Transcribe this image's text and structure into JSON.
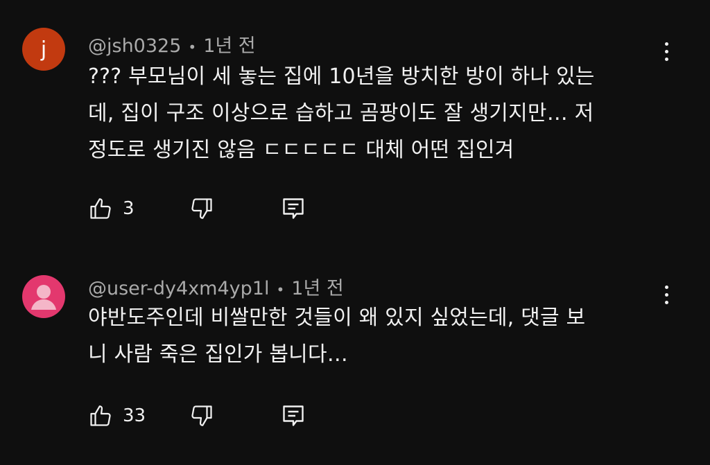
{
  "comments": [
    {
      "avatar_letter": "j",
      "avatar_color": "#c23a10",
      "author": "@jsh0325",
      "time": "1년 전",
      "text": "??? 부모님이 세 놓는 집에 10년을 방치한 방이 하나 있는\n데, 집이 구조 이상으로 습하고 곰팡이도 잘 생기지만… 저\n정도로 생기진 않음 ㄷㄷㄷㄷㄷ 대체 어떤 집인겨",
      "likes": "3"
    },
    {
      "avatar_color": "#e3386e",
      "author": "@user-dy4xm4yp1l",
      "time": "1년 전",
      "text": "야반도주인데 비쌀만한 것들이 왜 있지 싶었는데, 댓글 보\n니 사람 죽은 집인가 봅니다…",
      "likes": "33"
    }
  ],
  "separator": "•",
  "icons": {
    "like": "thumbs-up-icon",
    "dislike": "thumbs-down-icon",
    "reply": "comment-icon",
    "menu": "more-vertical-icon",
    "default_avatar": "person-icon"
  }
}
